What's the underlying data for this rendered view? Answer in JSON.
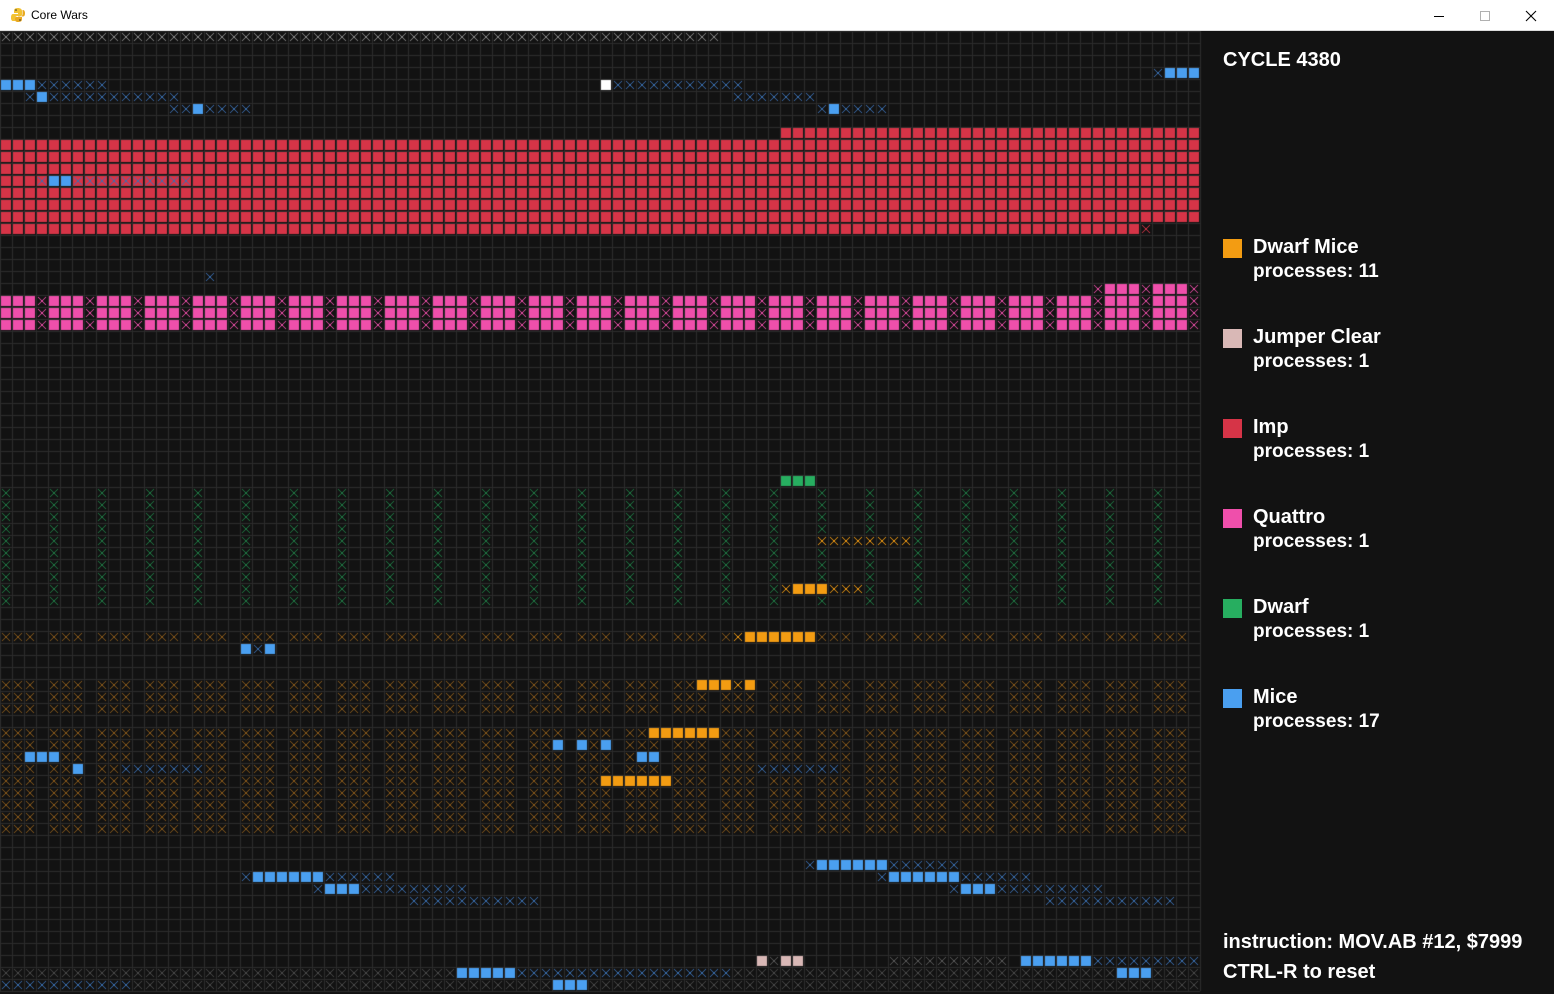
{
  "window": {
    "title": "Core Wars",
    "controls": {
      "minimize": "minimize-icon",
      "maximize": "maximize-icon",
      "close": "close-icon"
    }
  },
  "colors": {
    "background": "#121212",
    "grid": "#2c2c2c",
    "accent_white": "#ffffff"
  },
  "status": {
    "cycle_label": "CYCLE 4380"
  },
  "legend": [
    {
      "name": "Dwarf Mice",
      "processes": "processes: 11",
      "color": "#f39c12"
    },
    {
      "name": "Jumper Clear",
      "processes": "processes: 1",
      "color": "#d9b8b6"
    },
    {
      "name": "Imp",
      "processes": "processes: 1",
      "color": "#d63447"
    },
    {
      "name": "Quattro",
      "processes": "processes: 1",
      "color": "#ef4fab"
    },
    {
      "name": "Dwarf",
      "processes": "processes: 1",
      "color": "#27ae60"
    },
    {
      "name": "Mice",
      "processes": "processes: 17",
      "color": "#4a9ff0"
    }
  ],
  "footer": {
    "instruction": "instruction: MOV.AB #12, $7999",
    "reset_hint": "CTRL-R to reset"
  }
}
